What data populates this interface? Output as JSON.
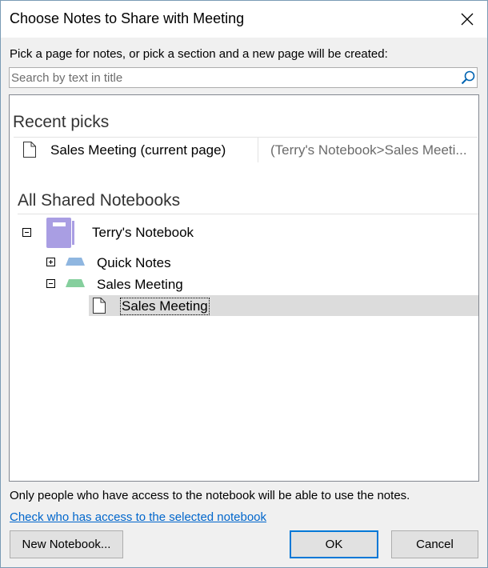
{
  "dialog": {
    "title": "Choose Notes to Share with Meeting",
    "instruction": "Pick a page for notes, or pick a section and a new page will be created:"
  },
  "search": {
    "placeholder": "Search by text in title",
    "value": ""
  },
  "recent": {
    "heading": "Recent picks",
    "items": [
      {
        "title": "Sales Meeting (current page)",
        "path": "(Terry's Notebook>Sales Meeti..."
      }
    ]
  },
  "shared": {
    "heading": "All Shared Notebooks",
    "notebook": {
      "name": "Terry's Notebook"
    },
    "sections": [
      {
        "name": "Quick Notes",
        "color": "#8fb6e0"
      },
      {
        "name": "Sales Meeting",
        "color": "#85cf9d"
      }
    ],
    "pages": [
      {
        "name": "Sales Meeting"
      }
    ]
  },
  "footer": {
    "note": "Only people who have access to the notebook will be able to use the notes.",
    "link": "Check who has access to the selected notebook"
  },
  "buttons": {
    "new_notebook": "New Notebook...",
    "ok": "OK",
    "cancel": "Cancel"
  },
  "colors": {
    "notebook": "#a99ee3",
    "accent": "#0078d7",
    "link": "#0066cc"
  }
}
